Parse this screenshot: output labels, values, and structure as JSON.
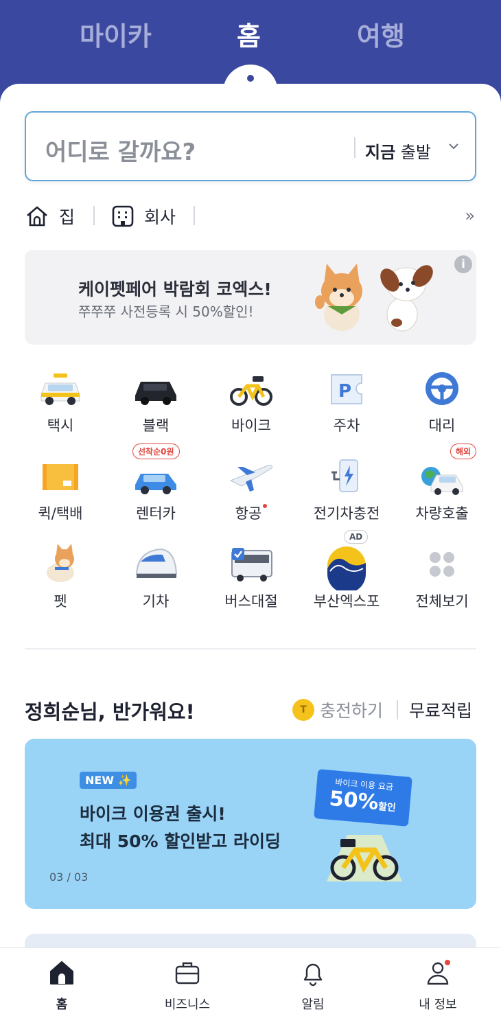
{
  "top_tabs": {
    "mycar": "마이카",
    "home": "홈",
    "travel": "여행"
  },
  "search": {
    "placeholder": "어디로 갈까요?",
    "depart_bold": "지금",
    "depart_rest": "출발"
  },
  "places": {
    "home": "집",
    "work": "회사"
  },
  "banner": {
    "title": "케이펫페어 박람회 코엑스!",
    "subtitle": "쭈쭈쭈 사전등록 시 50%할인!"
  },
  "services": [
    {
      "label": "택시",
      "icon": "taxi-icon"
    },
    {
      "label": "블랙",
      "icon": "black-car-icon"
    },
    {
      "label": "바이크",
      "icon": "bike-icon"
    },
    {
      "label": "주차",
      "icon": "parking-icon"
    },
    {
      "label": "대리",
      "icon": "steering-wheel-icon"
    },
    {
      "label": "퀵/택배",
      "icon": "parcel-box-icon"
    },
    {
      "label": "렌터카",
      "icon": "rental-car-icon",
      "badge": "선착순0원"
    },
    {
      "label": "항공",
      "icon": "airplane-icon",
      "dot": true
    },
    {
      "label": "전기차충전",
      "icon": "ev-charger-icon"
    },
    {
      "label": "차량호출",
      "icon": "car-call-icon",
      "badge": "해외"
    },
    {
      "label": "펫",
      "icon": "pet-icon"
    },
    {
      "label": "기차",
      "icon": "train-icon"
    },
    {
      "label": "버스대절",
      "icon": "bus-icon"
    },
    {
      "label": "부산엑스포",
      "icon": "busan-expo-icon",
      "badge": "AD"
    },
    {
      "label": "전체보기",
      "icon": "grid-icon"
    }
  ],
  "greeting": {
    "text": "정희순님, 반가워요!",
    "coin": "T",
    "charge": "충전하기",
    "free": "무료적립"
  },
  "promo": {
    "badge": "NEW",
    "line1": "바이크 이용권 출시!",
    "line2": "최대 50% 할인받고 라이딩",
    "pager": "03 / 03",
    "ticket_top": "바이크 이용 요금",
    "ticket_main": "50%",
    "ticket_suffix": "할인"
  },
  "bottom_nav": [
    {
      "label": "홈",
      "icon": "home-icon",
      "active": true
    },
    {
      "label": "비즈니스",
      "icon": "briefcase-icon"
    },
    {
      "label": "알림",
      "icon": "bell-icon"
    },
    {
      "label": "내 정보",
      "icon": "person-icon"
    }
  ],
  "colors": {
    "brand": "#3a48a0",
    "accent": "#2e7be8",
    "alert": "#e2463d"
  }
}
